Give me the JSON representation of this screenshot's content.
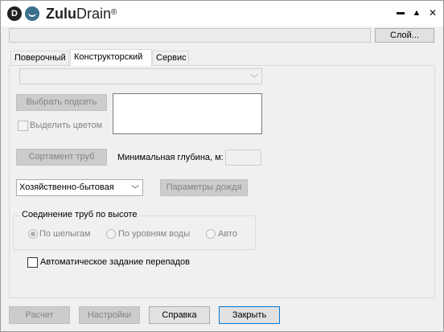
{
  "titlebar": {
    "logo_letter": "D",
    "brand_bold": "Zulu",
    "brand_regular": "Drain",
    "trademark": "®",
    "controls": {
      "minimize": "▬",
      "maximize": "▲",
      "close": "✕"
    }
  },
  "top": {
    "layer_value": "",
    "layer_button": "Слой..."
  },
  "tabs": [
    {
      "label": "Поверочный",
      "active": false
    },
    {
      "label": "Конструкторский",
      "active": true
    },
    {
      "label": "Сервис",
      "active": false
    }
  ],
  "panel": {
    "top_combo_value": "",
    "select_subnet_button": "Выбрать подсеть",
    "highlight_color_label": "Выделить цветом",
    "pipe_range_button": "Сортамент труб",
    "min_depth_label": "Минимальная глубина, м:",
    "min_depth_value": "",
    "sewer_type_value": "Хозяйственно-бытовая",
    "rain_params_button": "Параметры дождя",
    "connection_group": {
      "title": "Соединение труб по высоте",
      "options": [
        {
          "label": "По шелыгам",
          "checked": true
        },
        {
          "label": "По уровням воды",
          "checked": false
        },
        {
          "label": "Авто",
          "checked": false
        }
      ]
    },
    "auto_drops_label": "Автоматическое задание перепадов"
  },
  "footer": {
    "calc_button": "Расчет",
    "settings_button": "Настройки",
    "help_button": "Справка",
    "close_button": "Закрыть"
  },
  "colors": {
    "accent_focus": "#0078d7",
    "window_bg": "#f0f0f0",
    "brand_icon": "#3a6f8c"
  }
}
